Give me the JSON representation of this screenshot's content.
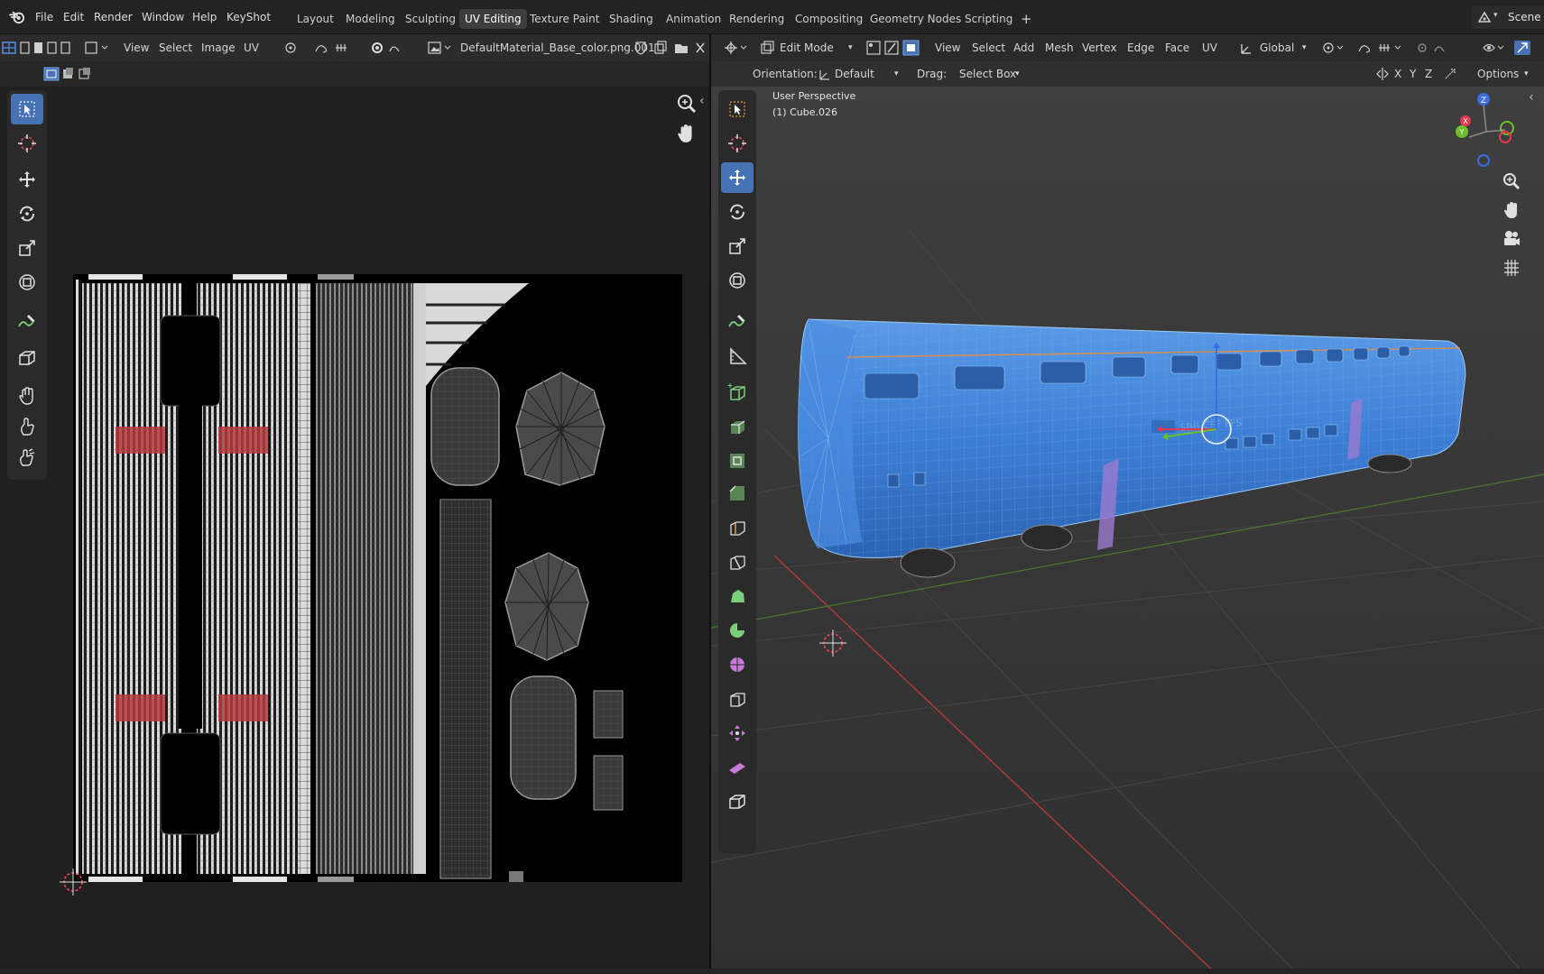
{
  "topbar": {
    "menus": [
      "File",
      "Edit",
      "Render",
      "Window",
      "Help",
      "KeyShot"
    ],
    "workspaces": [
      "Layout",
      "Modeling",
      "Sculpting",
      "UV Editing",
      "Texture Paint",
      "Shading",
      "Animation",
      "Rendering",
      "Compositing",
      "Geometry Nodes",
      "Scripting"
    ],
    "active_workspace": "UV Editing",
    "add_tab": "+",
    "scene_label": "Scene"
  },
  "uv_editor": {
    "menus": [
      "View",
      "Select",
      "Image",
      "UV"
    ],
    "image_name": "DefaultMaterial_Base_color.png.001",
    "tools": [
      "select-box",
      "cursor",
      "move",
      "rotate",
      "scale",
      "transform",
      "annotate",
      "rip-region",
      "grab",
      "relax",
      "pinch"
    ],
    "active_tool": "select-box"
  },
  "viewport": {
    "mode": "Edit Mode",
    "menus": [
      "View",
      "Select",
      "Add",
      "Mesh",
      "Vertex",
      "Edge",
      "Face",
      "UV"
    ],
    "transform_orientation": "Global",
    "orientation_label": "Orientation:",
    "orientation_value": "Default",
    "drag_label": "Drag:",
    "drag_value": "Select Box",
    "axis_labels": [
      "X",
      "Y",
      "Z"
    ],
    "options_label": "Options",
    "perspective_label": "User Perspective",
    "object_label": "(1) Cube.026",
    "active_tool": "move",
    "gizmo_axes": [
      "X",
      "Y",
      "Z"
    ],
    "body_logo_text": "SBB CFF FFS"
  },
  "colors": {
    "accent": "#4772b3",
    "mesh_blue": "#3d7fd6",
    "mesh_wire": "#7ab6f0",
    "uv_island_fill": "#4a4a4a",
    "uv_red": "#c0393b",
    "axis_x": "#e8384f",
    "axis_y": "#6cbf2a",
    "axis_z": "#3d6ee0"
  }
}
